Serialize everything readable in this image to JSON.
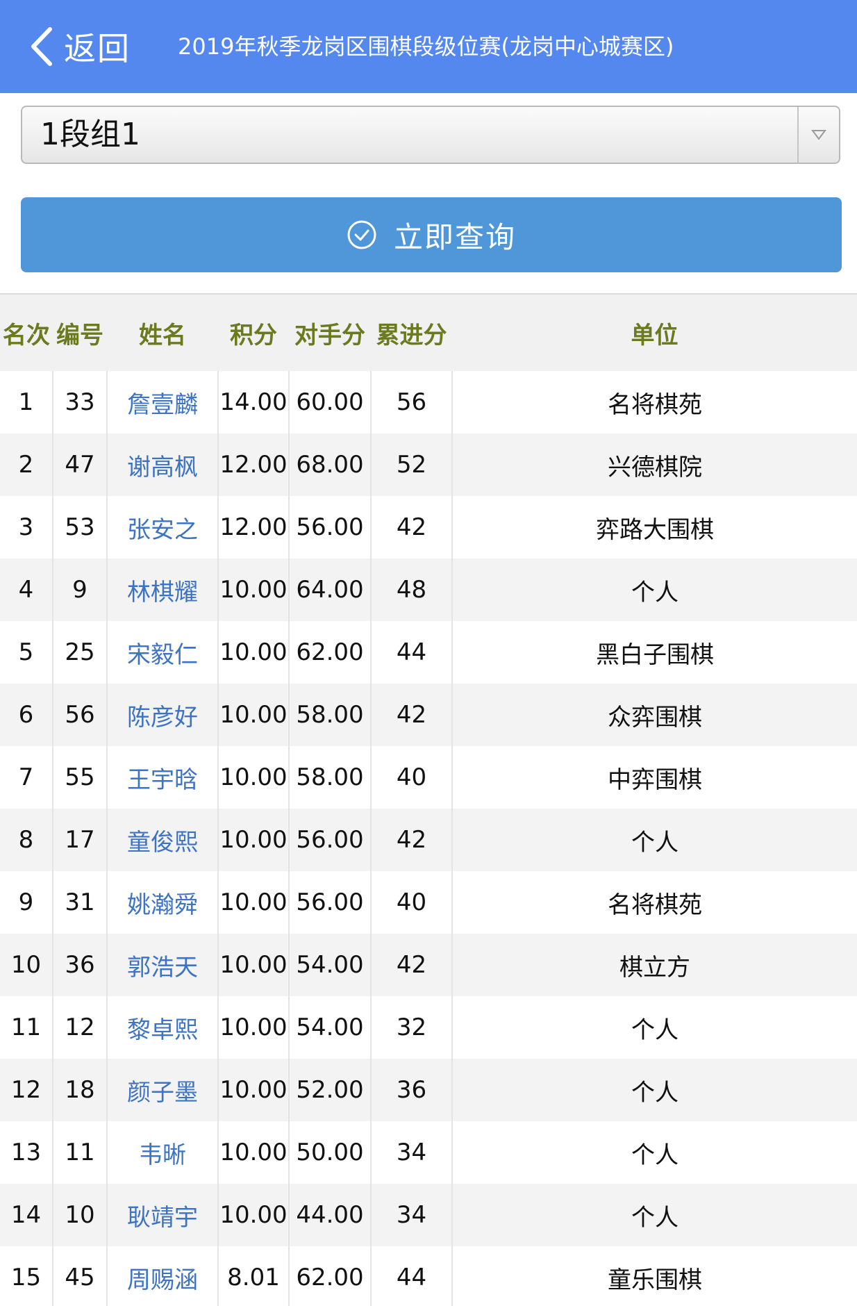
{
  "header": {
    "back_label": "返回",
    "title": "2019年秋季龙岗区围棋段级位赛(龙岗中心城赛区)"
  },
  "filter": {
    "selected_group": "1段组1"
  },
  "query_button": {
    "label": "立即查询"
  },
  "table": {
    "columns": [
      "名次",
      "编号",
      "姓名",
      "积分",
      "对手分",
      "累进分",
      "单位"
    ],
    "rows": [
      {
        "rank": "1",
        "id": "33",
        "name": "詹壹麟",
        "score": "14.00",
        "opp": "60.00",
        "prog": "56",
        "unit": "名将棋苑"
      },
      {
        "rank": "2",
        "id": "47",
        "name": "谢高枫",
        "score": "12.00",
        "opp": "68.00",
        "prog": "52",
        "unit": "兴德棋院"
      },
      {
        "rank": "3",
        "id": "53",
        "name": "张安之",
        "score": "12.00",
        "opp": "56.00",
        "prog": "42",
        "unit": "弈路大围棋"
      },
      {
        "rank": "4",
        "id": "9",
        "name": "林棋耀",
        "score": "10.00",
        "opp": "64.00",
        "prog": "48",
        "unit": "个人"
      },
      {
        "rank": "5",
        "id": "25",
        "name": "宋毅仁",
        "score": "10.00",
        "opp": "62.00",
        "prog": "44",
        "unit": "黑白子围棋"
      },
      {
        "rank": "6",
        "id": "56",
        "name": "陈彦好",
        "score": "10.00",
        "opp": "58.00",
        "prog": "42",
        "unit": "众弈围棋"
      },
      {
        "rank": "7",
        "id": "55",
        "name": "王宇晗",
        "score": "10.00",
        "opp": "58.00",
        "prog": "40",
        "unit": "中弈围棋"
      },
      {
        "rank": "8",
        "id": "17",
        "name": "童俊熙",
        "score": "10.00",
        "opp": "56.00",
        "prog": "42",
        "unit": "个人"
      },
      {
        "rank": "9",
        "id": "31",
        "name": "姚瀚舜",
        "score": "10.00",
        "opp": "56.00",
        "prog": "40",
        "unit": "名将棋苑"
      },
      {
        "rank": "10",
        "id": "36",
        "name": "郭浩天",
        "score": "10.00",
        "opp": "54.00",
        "prog": "42",
        "unit": "棋立方"
      },
      {
        "rank": "11",
        "id": "12",
        "name": "黎卓熙",
        "score": "10.00",
        "opp": "54.00",
        "prog": "32",
        "unit": "个人"
      },
      {
        "rank": "12",
        "id": "18",
        "name": "颜子墨",
        "score": "10.00",
        "opp": "52.00",
        "prog": "36",
        "unit": "个人"
      },
      {
        "rank": "13",
        "id": "11",
        "name": "韦晰",
        "score": "10.00",
        "opp": "50.00",
        "prog": "34",
        "unit": "个人"
      },
      {
        "rank": "14",
        "id": "10",
        "name": "耿靖宇",
        "score": "10.00",
        "opp": "44.00",
        "prog": "34",
        "unit": "个人"
      },
      {
        "rank": "15",
        "id": "45",
        "name": "周赐涵",
        "score": "8.01",
        "opp": "62.00",
        "prog": "44",
        "unit": "童乐围棋"
      }
    ]
  },
  "colors": {
    "header_bg": "#5588ee",
    "button_bg": "#4f97d9",
    "column_header_text": "#6b7a1f",
    "name_link": "#3d73c4"
  },
  "icons": {
    "back": "chevron-left-icon",
    "dropdown": "triangle-down-icon",
    "query": "check-circle-icon"
  }
}
